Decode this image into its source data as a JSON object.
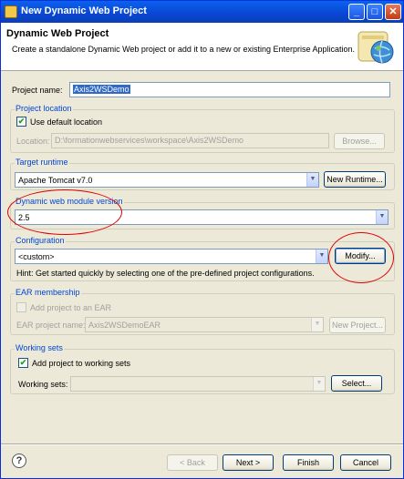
{
  "window": {
    "title": "New Dynamic Web Project",
    "minimize_label": "_",
    "maximize_label": "□",
    "close_label": "✕"
  },
  "header": {
    "title": "Dynamic Web Project",
    "description": "Create a standalone Dynamic Web project or add it to a new or existing Enterprise Application."
  },
  "project_name": {
    "label": "Project name:",
    "value": "Axis2WSDemo"
  },
  "project_location": {
    "group_title": "Project location",
    "use_default_label": "Use default location",
    "use_default_checked": true,
    "location_label": "Location:",
    "location_value": "D:\\formationwebservices\\workspace\\Axis2WSDemo",
    "browse_label": "Browse..."
  },
  "target_runtime": {
    "group_title": "Target runtime",
    "value": "Apache Tomcat v7.0",
    "new_runtime_label": "New Runtime..."
  },
  "module_version": {
    "group_title": "Dynamic web module version",
    "value": "2.5"
  },
  "configuration": {
    "group_title": "Configuration",
    "value": "<custom>",
    "modify_label": "Modify...",
    "hint": "Hint: Get started quickly by selecting one of the pre-defined project configurations."
  },
  "ear_membership": {
    "group_title": "EAR membership",
    "add_label": "Add project to an EAR",
    "add_checked": false,
    "ear_name_label": "EAR project name:",
    "ear_name_value": "Axis2WSDemoEAR",
    "new_project_label": "New Project..."
  },
  "working_sets": {
    "group_title": "Working sets",
    "add_label": "Add project to working sets",
    "add_checked": true,
    "sets_label": "Working sets:",
    "sets_value": "",
    "select_label": "Select..."
  },
  "footer": {
    "help_label": "?",
    "back_label": "< Back",
    "next_label": "Next >",
    "finish_label": "Finish",
    "cancel_label": "Cancel"
  },
  "icons": {
    "check": "✔",
    "dropdown": "▼"
  }
}
